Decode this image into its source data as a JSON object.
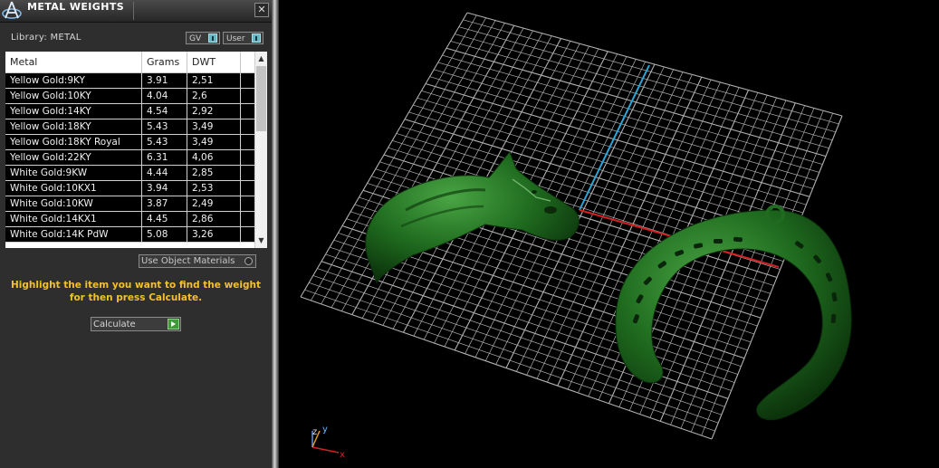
{
  "window": {
    "title": "METAL WEIGHTS",
    "close_glyph": "✕"
  },
  "library": {
    "label": "Library: METAL",
    "gv_label": "GV",
    "user_label": "User"
  },
  "table": {
    "columns": [
      "Metal",
      "Grams",
      "DWT"
    ],
    "rows": [
      {
        "metal": "Yellow Gold:9KY",
        "grams": "3.91",
        "dwt": "2,51"
      },
      {
        "metal": "Yellow Gold:10KY",
        "grams": "4.04",
        "dwt": "2,6"
      },
      {
        "metal": "Yellow Gold:14KY",
        "grams": "4.54",
        "dwt": "2,92"
      },
      {
        "metal": "Yellow Gold:18KY",
        "grams": "5.43",
        "dwt": "3,49"
      },
      {
        "metal": "Yellow Gold:18KY Royal",
        "grams": "5.43",
        "dwt": "3,49"
      },
      {
        "metal": "Yellow Gold:22KY",
        "grams": "6.31",
        "dwt": "4,06"
      },
      {
        "metal": "White Gold:9KW",
        "grams": "4.44",
        "dwt": "2,85"
      },
      {
        "metal": "White Gold:10KX1",
        "grams": "3.94",
        "dwt": "2,53"
      },
      {
        "metal": "White Gold:10KW",
        "grams": "3.87",
        "dwt": "2,49"
      },
      {
        "metal": "White Gold:14KX1",
        "grams": "4.45",
        "dwt": "2,86"
      },
      {
        "metal": "White Gold:14K PdW",
        "grams": "5.08",
        "dwt": "3,26"
      }
    ]
  },
  "use_object_materials_label": "Use Object Materials",
  "instruction": "Highlight the item you want to find the weight for then press Calculate.",
  "calculate_label": "Calculate",
  "viewport": {
    "axis_labels": {
      "x": "x",
      "y": "y",
      "z": "z"
    },
    "colors": {
      "background": "#000000",
      "grid": "#cfcfcf",
      "axis_x": "#d42020",
      "axis_y": "#2aa7d8",
      "model": "#1f6b1f",
      "model_highlight": "#3f9a3a"
    }
  }
}
